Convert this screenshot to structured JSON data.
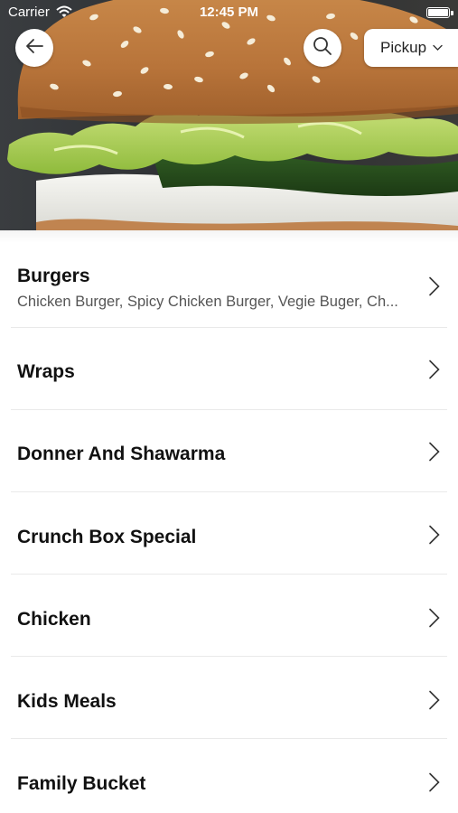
{
  "status_bar": {
    "carrier": "Carrier",
    "time": "12:45 PM"
  },
  "header": {
    "back_icon": "arrow-left-icon",
    "search_icon": "search-icon",
    "order_mode": "Pickup"
  },
  "categories": [
    {
      "title": "Burgers",
      "subtitle": "Chicken Burger, Spicy Chicken Burger, Vegie Buger, Ch..."
    },
    {
      "title": "Wraps"
    },
    {
      "title": "Donner And Shawarma"
    },
    {
      "title": "Crunch Box Special"
    },
    {
      "title": "Chicken"
    },
    {
      "title": "Kids Meals"
    },
    {
      "title": "Family Bucket"
    }
  ],
  "colors": {
    "text_primary": "#111111",
    "text_secondary": "#555555",
    "divider": "#e9e9e9",
    "chevron": "#333333"
  }
}
